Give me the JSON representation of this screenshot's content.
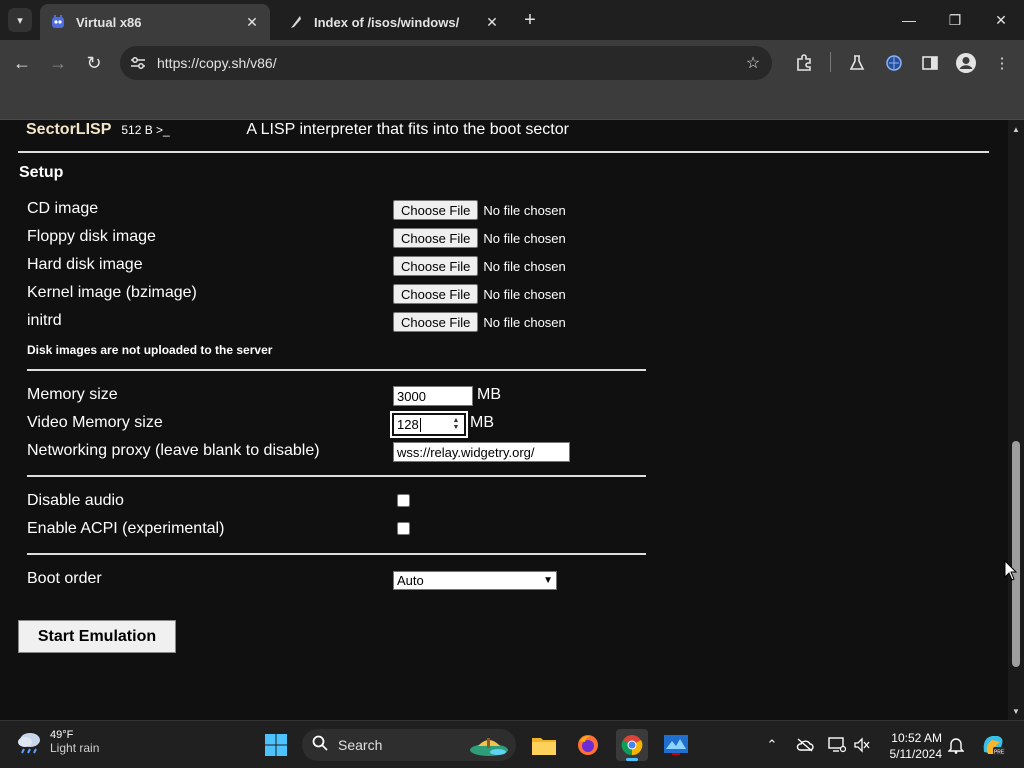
{
  "browser": {
    "tabs": [
      {
        "title": "Virtual x86",
        "favicon": "v86-icon",
        "active": true
      },
      {
        "title": "Index of /isos/windows/",
        "favicon": "apache-feather-icon",
        "active": false
      }
    ],
    "url": "https://copy.sh/v86/"
  },
  "page": {
    "os_entry": {
      "name": "SectorLISP",
      "size": "512 B >_",
      "description": "A LISP interpreter that fits into the boot sector"
    },
    "setup_title": "Setup",
    "file_inputs": [
      {
        "label": "CD image",
        "button": "Choose File",
        "status": "No file chosen"
      },
      {
        "label": "Floppy disk image",
        "button": "Choose File",
        "status": "No file chosen"
      },
      {
        "label": "Hard disk image",
        "button": "Choose File",
        "status": "No file chosen"
      },
      {
        "label": "Kernel image (bzimage)",
        "button": "Choose File",
        "status": "No file chosen"
      },
      {
        "label": "initrd",
        "button": "Choose File",
        "status": "No file chosen"
      }
    ],
    "disk_note": "Disk images are not uploaded to the server",
    "memory": {
      "label": "Memory size",
      "value": "3000",
      "unit": "MB"
    },
    "video_memory": {
      "label": "Video Memory size",
      "value": "128",
      "unit": "MB"
    },
    "proxy": {
      "label": "Networking proxy (leave blank to disable)",
      "value": "wss://relay.widgetry.org/"
    },
    "disable_audio": {
      "label": "Disable audio",
      "checked": false
    },
    "enable_acpi": {
      "label": "Enable ACPI (experimental)",
      "checked": false
    },
    "boot_order": {
      "label": "Boot order",
      "selected": "Auto"
    },
    "start_button": "Start Emulation"
  },
  "taskbar": {
    "weather": {
      "temp": "49°F",
      "condition": "Light rain"
    },
    "search_label": "Search",
    "time": "10:52 AM",
    "date": "5/11/2024"
  },
  "colors": {
    "page_bg": "#101010",
    "os_name": "#f2e5c8",
    "chrome_toolbar": "#3c3c3c",
    "taskbar": "#202020"
  }
}
